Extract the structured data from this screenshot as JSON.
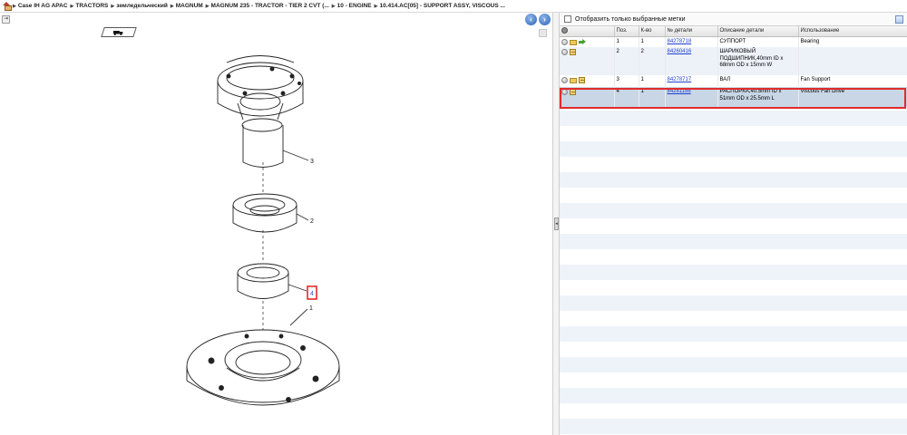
{
  "breadcrumb": {
    "items": [
      "Case IH AG APAC",
      "TRACTORS",
      "земледельческий",
      "MAGNUM",
      "MAGNUM 235 - TRACTOR - TIER 2 CVT (...",
      "10 - ENGINE",
      "10.414.AC[05] - SUPPORT ASSY, VISCOUS ..."
    ]
  },
  "diagram": {
    "callouts": {
      "part3": "3",
      "part2": "2",
      "part1": "1",
      "part4": "4"
    }
  },
  "right": {
    "filter_label": "Отобразить только выбранные метки"
  },
  "table": {
    "headers": [
      "Поз.",
      "К-во",
      "№ детали",
      "Описание детали",
      "Использование"
    ],
    "rows": [
      {
        "pos": "1",
        "qty": "1",
        "part_no": "84278718",
        "desc": "СУППОРТ",
        "usage": "Bearing"
      },
      {
        "pos": "2",
        "qty": "2",
        "part_no": "84260416",
        "desc": "ШАРИКОВЫЙ ПОДШИПНИК,40mm ID x 68mm OD x 15mm W",
        "usage": ""
      },
      {
        "pos": "3",
        "qty": "1",
        "part_no": "84278717",
        "desc": "ВАЛ",
        "usage": "Fan Support"
      },
      {
        "pos": "4",
        "qty": "1",
        "part_no": "84281188",
        "desc": "РАСПОРКА,40.5mm ID x 51mm OD x 25.5mm L",
        "usage": "Viscous Fan Drive"
      }
    ]
  },
  "colors": {
    "selection_border": "#e12b2b",
    "link": "#1f3fd0",
    "selected_row": "#c8d6e5"
  }
}
